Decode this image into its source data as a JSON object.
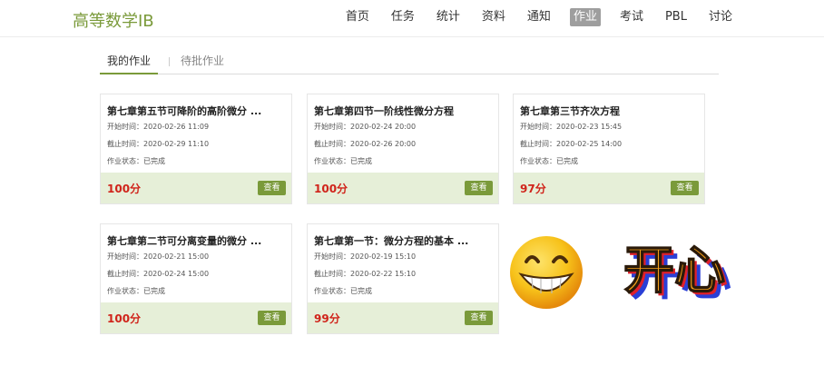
{
  "header": {
    "brand": "高等数学IB",
    "nav": [
      {
        "label": "首页",
        "active": false
      },
      {
        "label": "任务",
        "active": false
      },
      {
        "label": "统计",
        "active": false
      },
      {
        "label": "资料",
        "active": false
      },
      {
        "label": "通知",
        "active": false
      },
      {
        "label": "作业",
        "active": true
      },
      {
        "label": "考试",
        "active": false
      },
      {
        "label": "PBL",
        "active": false
      },
      {
        "label": "讨论",
        "active": false
      }
    ]
  },
  "tabs": [
    {
      "label": "我的作业",
      "active": true
    },
    {
      "label": "待批作业",
      "active": false
    }
  ],
  "labels": {
    "start": "开始时间：",
    "end": "截止时间：",
    "status": "作业状态："
  },
  "assignments": [
    {
      "title": "第七章第五节可降阶的高阶微分 ...",
      "start": "2020-02-26 11:09",
      "end": "2020-02-29 11:10",
      "status": "已完成",
      "score": "100分",
      "button": "查看"
    },
    {
      "title": "第七章第四节一阶线性微分方程",
      "start": "2020-02-24 20:00",
      "end": "2020-02-26 20:00",
      "status": "已完成",
      "score": "100分",
      "button": "查看"
    },
    {
      "title": "第七章第三节齐次方程",
      "start": "2020-02-23 15:45",
      "end": "2020-02-25 14:00",
      "status": "已完成",
      "score": "97分",
      "button": "查看"
    },
    {
      "title": "第七章第二节可分离变量的微分 ...",
      "start": "2020-02-21 15:00",
      "end": "2020-02-24 15:00",
      "status": "已完成",
      "score": "100分",
      "button": "查看"
    },
    {
      "title": "第七章第一节：微分方程的基本 ...",
      "start": "2020-02-19 15:10",
      "end": "2020-02-22 15:10",
      "status": "已完成",
      "score": "99分",
      "button": "查看"
    }
  ],
  "sticker": {
    "text": "开心",
    "icon": "grinning-face-emoji",
    "colors": {
      "face": "#f7c21a",
      "face_edge": "#e58a0b",
      "letters": "#f5a019",
      "shadow_red": "#e0202a",
      "shadow_blue": "#2a3fd6"
    }
  },
  "theme": {
    "accent": "#7a9a3a",
    "score": "#d0241b",
    "card_footer": "#e6efd8"
  }
}
